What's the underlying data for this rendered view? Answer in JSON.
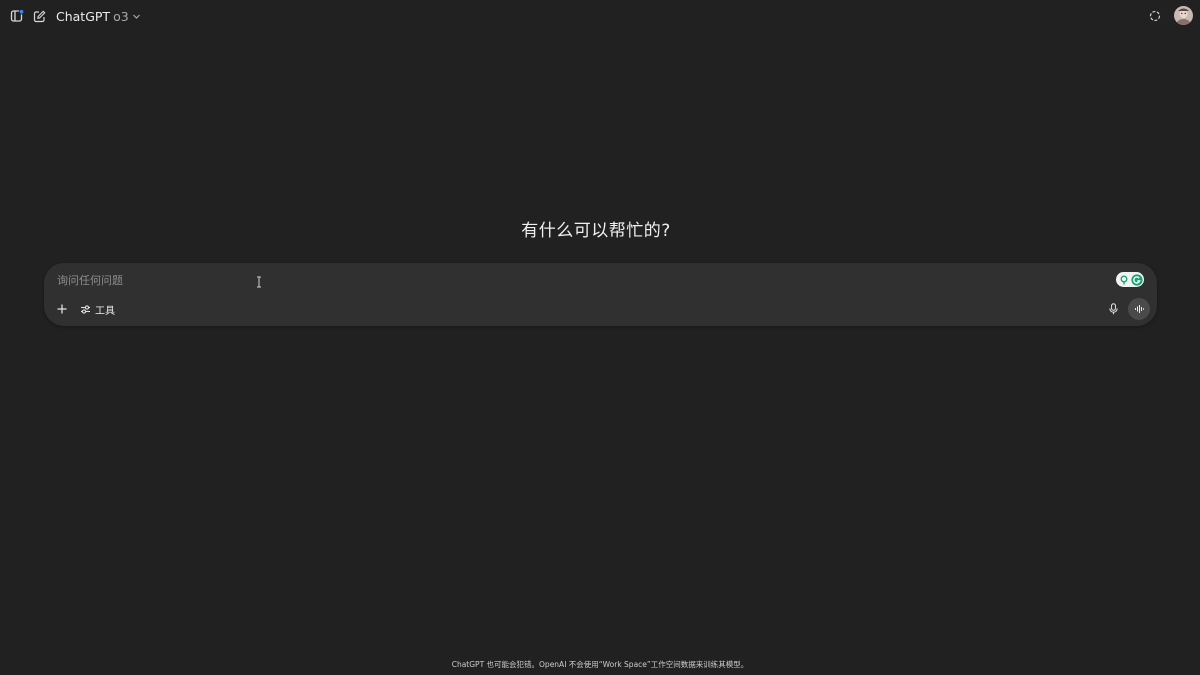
{
  "header": {
    "model_name": "ChatGPT",
    "model_version": "o3",
    "icons": {
      "sidebar_toggle": "sidebar-toggle-icon",
      "new_chat": "new-chat-icon",
      "dropdown": "chevron-down-icon",
      "temporary_chat": "temporary-chat-icon",
      "avatar": "user-avatar"
    },
    "notification_color": "#3b82f6"
  },
  "main": {
    "greeting": "有什么可以帮忙的?"
  },
  "composer": {
    "placeholder": "询问任何问题",
    "value": "",
    "tools_label": "工具",
    "icons": {
      "plus": "plus-icon",
      "tools": "sliders-icon",
      "mic": "mic-icon",
      "voice_mode": "voice-waveform-icon",
      "extension": "grammarly-extension-icon"
    },
    "extension_color": "#15a36e"
  },
  "footer": {
    "disclaimer": "ChatGPT 也可能会犯错。OpenAI 不会使用“Work Space”工作空间数据来训练其模型。"
  }
}
